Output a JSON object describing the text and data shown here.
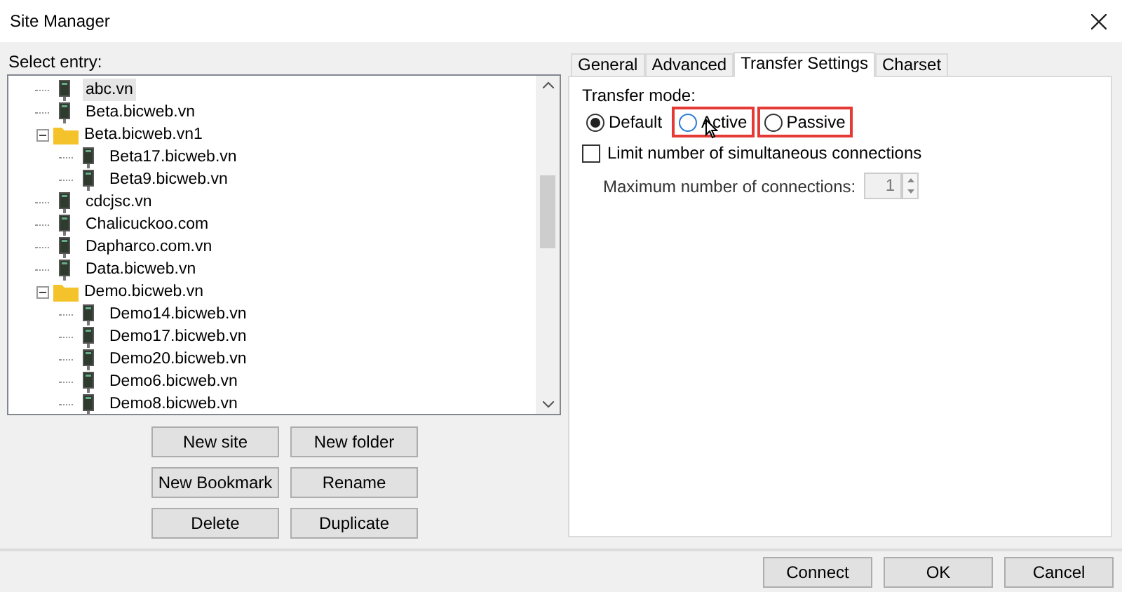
{
  "window": {
    "title": "Site Manager"
  },
  "select_label": "Select entry:",
  "tree": [
    {
      "kind": "server",
      "label": "abc.vn",
      "selected": true
    },
    {
      "kind": "server",
      "label": "Beta.bicweb.vn",
      "selected": false
    },
    {
      "kind": "folder",
      "label": "Beta.bicweb.vn1",
      "selected": false,
      "expanded": true,
      "children": [
        {
          "kind": "server",
          "label": "Beta17.bicweb.vn",
          "selected": false
        },
        {
          "kind": "server",
          "label": "Beta9.bicweb.vn",
          "selected": false
        }
      ]
    },
    {
      "kind": "server",
      "label": "cdcjsc.vn",
      "selected": false
    },
    {
      "kind": "server",
      "label": "Chalicuckoo.com",
      "selected": false
    },
    {
      "kind": "server",
      "label": "Dapharco.com.vn",
      "selected": false
    },
    {
      "kind": "server",
      "label": "Data.bicweb.vn",
      "selected": false
    },
    {
      "kind": "folder",
      "label": "Demo.bicweb.vn",
      "selected": false,
      "expanded": true,
      "children": [
        {
          "kind": "server",
          "label": "Demo14.bicweb.vn",
          "selected": false
        },
        {
          "kind": "server",
          "label": "Demo17.bicweb.vn",
          "selected": false
        },
        {
          "kind": "server",
          "label": "Demo20.bicweb.vn",
          "selected": false
        },
        {
          "kind": "server",
          "label": "Demo6.bicweb.vn",
          "selected": false
        },
        {
          "kind": "server",
          "label": "Demo8.bicweb.vn",
          "selected": false
        }
      ]
    }
  ],
  "tree_buttons": [
    "New site",
    "New folder",
    "New Bookmark",
    "Rename",
    "Delete",
    "Duplicate"
  ],
  "tabs": [
    {
      "label": "General",
      "selected": false
    },
    {
      "label": "Advanced",
      "selected": false
    },
    {
      "label": "Transfer Settings",
      "selected": true
    },
    {
      "label": "Charset",
      "selected": false
    }
  ],
  "transfer_mode": {
    "label": "Transfer mode:",
    "options": [
      {
        "label": "Default",
        "selected": true,
        "highlighted": false
      },
      {
        "label": "Active",
        "selected": false,
        "highlighted": true,
        "hovered": true
      },
      {
        "label": "Passive",
        "selected": false,
        "highlighted": true
      }
    ]
  },
  "limit_connections": {
    "label": "Limit number of simultaneous connections",
    "checked": false
  },
  "max_connections": {
    "label": "Maximum number of connections:",
    "value": "1",
    "disabled": true
  },
  "footer_buttons": [
    "Connect",
    "OK",
    "Cancel"
  ]
}
